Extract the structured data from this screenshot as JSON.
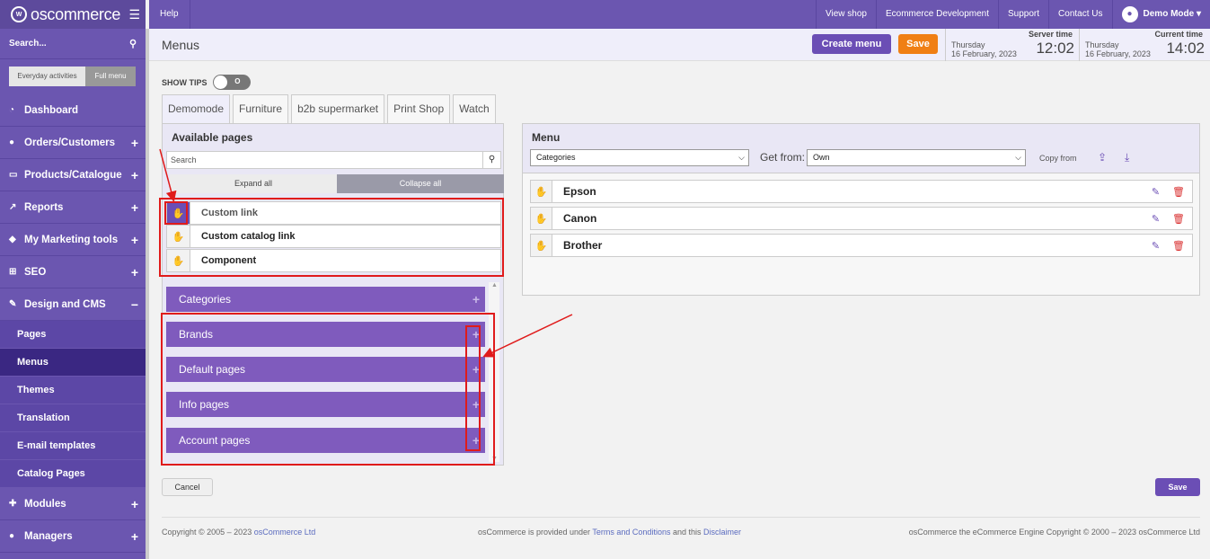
{
  "sidebar": {
    "logo_text": "oscommerce",
    "search_label": "Search...",
    "toggle": {
      "everyday": "Everyday activities",
      "full": "Full menu"
    },
    "items": [
      {
        "label": "Dashboard",
        "icon": "dashboard-icon"
      },
      {
        "label": "Orders/Customers",
        "icon": "users-icon"
      },
      {
        "label": "Products/Catalogue",
        "icon": "folder-icon"
      },
      {
        "label": "Reports",
        "icon": "chart-icon"
      },
      {
        "label": "My Marketing tools",
        "icon": "tag-icon"
      },
      {
        "label": "SEO",
        "icon": "sitemap-icon"
      },
      {
        "label": "Design and CMS",
        "icon": "brush-icon"
      }
    ],
    "sub_items": [
      "Pages",
      "Menus",
      "Themes",
      "Translation",
      "E-mail templates",
      "Catalog Pages"
    ],
    "bottom_items": [
      {
        "label": "Modules",
        "icon": "puzzle-icon"
      },
      {
        "label": "Managers",
        "icon": "user-icon"
      }
    ]
  },
  "topbar": {
    "help": "Help",
    "links": [
      "View shop",
      "Ecommerce Development",
      "Support",
      "Contact Us"
    ],
    "user": "Demo Mode"
  },
  "header": {
    "title": "Menus",
    "create_menu": "Create menu",
    "save": "Save",
    "server_time": {
      "label": "Server time",
      "day": "Thursday",
      "date": "16 February, 2023",
      "time": "12:02"
    },
    "current_time": {
      "label": "Current time",
      "day": "Thursday",
      "date": "16 February, 2023",
      "time": "14:02"
    }
  },
  "main": {
    "show_tips": "SHOW TIPS",
    "switch_text": "O",
    "tabs": [
      "Demomode",
      "Furniture",
      "b2b supermarket",
      "Print Shop",
      "Watch"
    ],
    "available": {
      "title": "Available pages",
      "search_placeholder": "Search",
      "expand_all": "Expand all",
      "collapse_all": "Collapse all",
      "pages": [
        "Custom link",
        "Custom catalog link",
        "Component"
      ],
      "sections": [
        "Categories",
        "Brands",
        "Default pages",
        "Info pages",
        "Account pages"
      ]
    },
    "menu": {
      "title": "Menu",
      "select_value": "Categories",
      "get_from_label": "Get from:",
      "get_from_value": "Own",
      "copy_from": "Copy from",
      "items": [
        "Epson",
        "Canon",
        "Brother"
      ]
    },
    "cancel": "Cancel",
    "save": "Save"
  },
  "footer": {
    "left_prefix": "Copyright © 2005 – 2023",
    "left_link": "osCommerce Ltd",
    "mid_prefix": "osCommerce is provided under",
    "mid_link1": "Terms and Conditions",
    "mid_and": "and this",
    "mid_link2": "Disclaimer",
    "right": "osCommerce the eCommerce Engine Copyright © 2000 – 2023 osCommerce Ltd"
  },
  "colors": {
    "accent": "#6b56b0",
    "orange": "#f07f14",
    "annotation_red": "#e01b1b"
  }
}
